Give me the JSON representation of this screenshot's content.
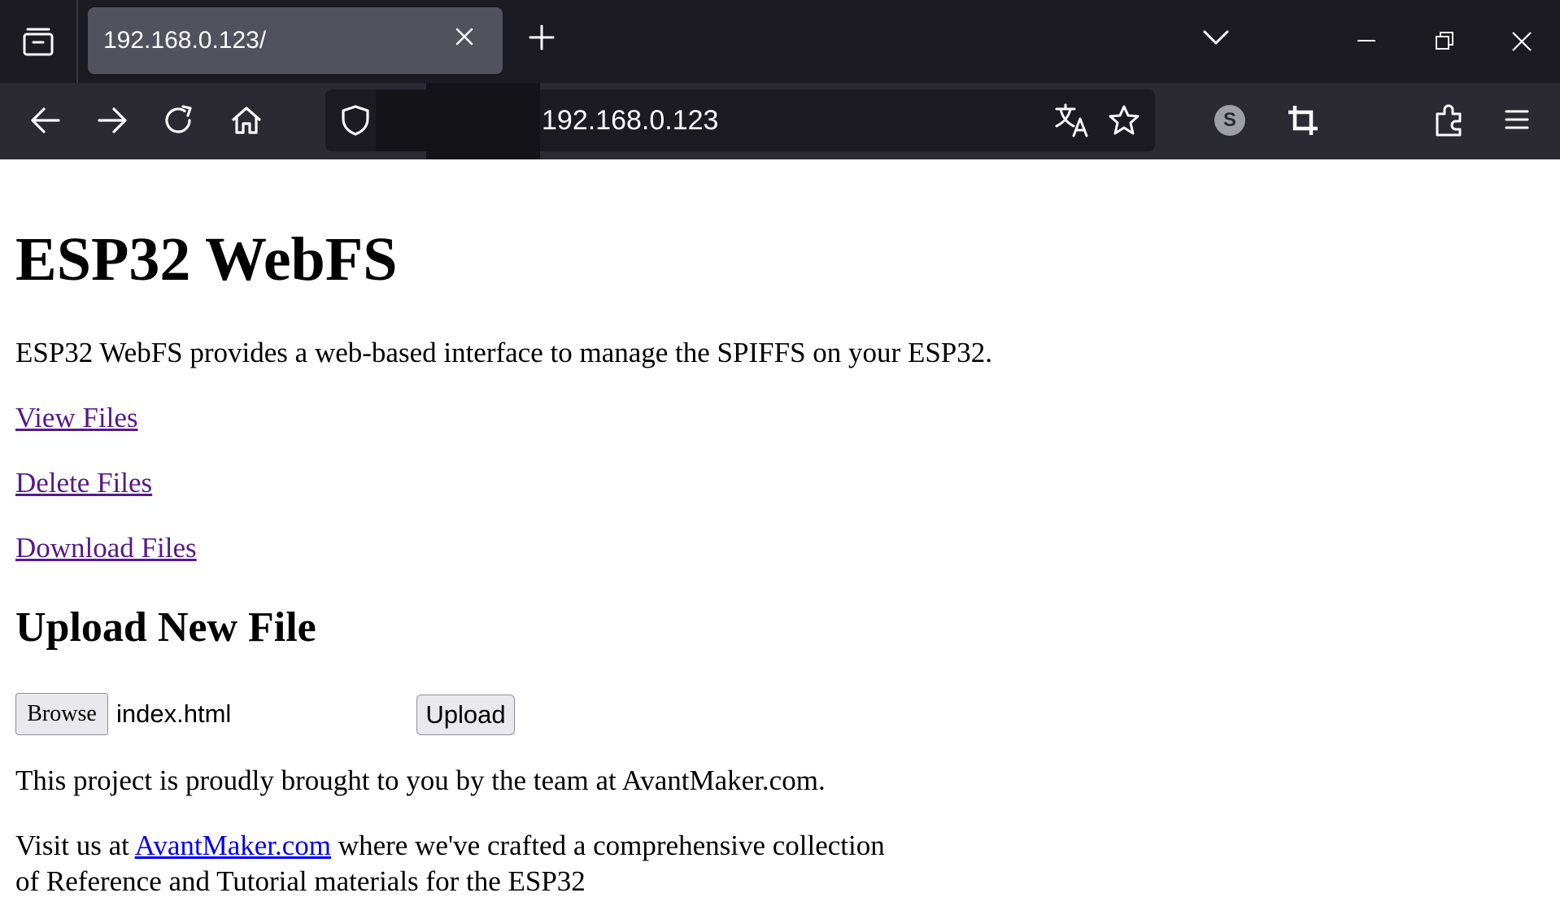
{
  "browser": {
    "tab_title": "192.168.0.123/",
    "url": "192.168.0.123",
    "account_initial": "S",
    "icons": {
      "tab_list": "tab-list-icon",
      "tab_close": "close-icon",
      "new_tab": "plus-icon",
      "tab_overflow": "chevron-down-icon",
      "minimize": "minimize-icon",
      "restore": "restore-icon",
      "close_window": "close-icon",
      "back": "arrow-left-icon",
      "forward": "arrow-right-icon",
      "reload": "reload-icon",
      "home": "home-icon",
      "tracking_protection": "shield-icon",
      "translate": "translate-icon",
      "bookmark": "star-icon",
      "screenshot": "crop-icon",
      "extensions": "puzzle-icon",
      "menu": "hamburger-icon"
    },
    "colors": {
      "tabbar_bg": "#1c1b22",
      "navbar_bg": "#2b2a33",
      "active_tab_bg": "#52525e"
    }
  },
  "page": {
    "title": "ESP32 WebFS",
    "intro": "ESP32 WebFS provides a web-based interface to manage the SPIFFS on your ESP32.",
    "links": {
      "view_files": "View Files",
      "delete_files": "Delete Files",
      "download_files": "Download Files"
    },
    "upload": {
      "heading": "Upload New File",
      "browse_label": "Browse",
      "selected_file": "index.html",
      "upload_label": "Upload"
    },
    "credit": "This project is proudly brought to you by the team at AvantMaker.com.",
    "visit": {
      "prefix": "Visit us at ",
      "link_text": "AvantMaker.com",
      "suffix": " where we've crafted a comprehensive collection",
      "line2": "of Reference and Tutorial materials for the ESP32"
    }
  }
}
